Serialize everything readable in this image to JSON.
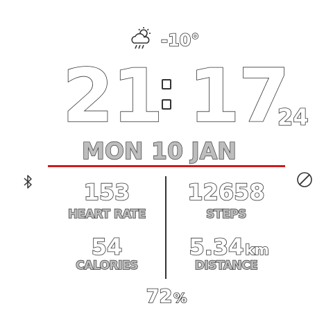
{
  "weather": {
    "icon": "partly-cloudy-rain-icon",
    "temperature": "-10°"
  },
  "time": {
    "hours": "21",
    "minutes": "17",
    "seconds": "24"
  },
  "date": "MON 10 JAN",
  "colors": {
    "divider": "#d0191c",
    "outline": "#333333",
    "date_fill": "#bdbdbd"
  },
  "status": {
    "bluetooth_icon": "bluetooth-icon",
    "dnd_icon": "do-not-disturb-icon"
  },
  "stats": {
    "heart_rate": {
      "value": "153",
      "label": "HEART RATE"
    },
    "steps": {
      "value": "12658",
      "label": "STEPS"
    },
    "calories": {
      "value": "54",
      "label": "CALORIES"
    },
    "distance": {
      "value": "5.34",
      "unit": "km",
      "label": "DISTANCE"
    }
  },
  "battery": {
    "value": "72",
    "unit": "%"
  }
}
